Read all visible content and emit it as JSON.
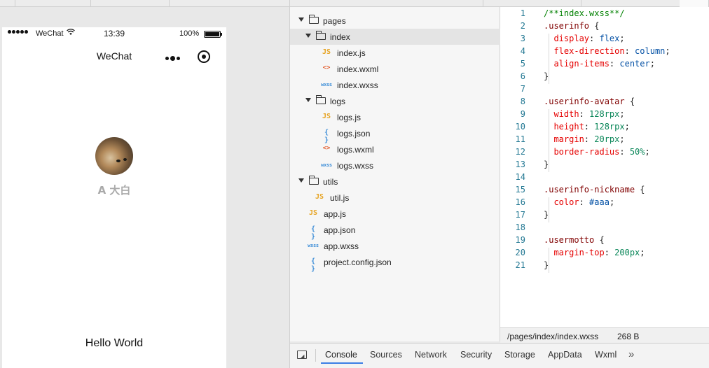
{
  "simulator": {
    "status": {
      "carrier": "WeChat",
      "time": "13:39",
      "battery_pct": "100%",
      "battery_level": 1.0
    },
    "nav_title": "WeChat",
    "nickname": "A 大白",
    "motto": "Hello World"
  },
  "filetree": {
    "items": [
      {
        "label": "pages",
        "type": "folder",
        "indent": 0,
        "expanded": true
      },
      {
        "label": "index",
        "type": "folder",
        "indent": 1,
        "expanded": true,
        "selected": true
      },
      {
        "label": "index.js",
        "type": "js",
        "indent": 2,
        "icon": "JS"
      },
      {
        "label": "index.wxml",
        "type": "wxml",
        "indent": 2,
        "icon": "<>"
      },
      {
        "label": "index.wxss",
        "type": "wxss",
        "indent": 2,
        "icon": "wxss"
      },
      {
        "label": "logs",
        "type": "folder",
        "indent": 1,
        "expanded": true
      },
      {
        "label": "logs.js",
        "type": "js",
        "indent": 2,
        "icon": "JS"
      },
      {
        "label": "logs.json",
        "type": "json",
        "indent": 2,
        "icon": "{ }"
      },
      {
        "label": "logs.wxml",
        "type": "wxml",
        "indent": 2,
        "icon": "<>"
      },
      {
        "label": "logs.wxss",
        "type": "wxss",
        "indent": 2,
        "icon": "wxss"
      },
      {
        "label": "utils",
        "type": "folder",
        "indent": 0,
        "expanded": true
      },
      {
        "label": "util.js",
        "type": "js",
        "indent": 1,
        "icon": "JS"
      },
      {
        "label": "app.js",
        "type": "js",
        "indent": 0,
        "icon": "JS"
      },
      {
        "label": "app.json",
        "type": "json",
        "indent": 0,
        "icon": "{ }"
      },
      {
        "label": "app.wxss",
        "type": "wxss",
        "indent": 0,
        "icon": "wxss"
      },
      {
        "label": "project.config.json",
        "type": "json",
        "indent": 0,
        "icon": "{ }"
      }
    ]
  },
  "editor": {
    "lines": [
      {
        "n": "1",
        "tokens": [
          [
            "c-comment",
            "/**index.wxss**/"
          ]
        ]
      },
      {
        "n": "2",
        "tokens": [
          [
            "c-selector",
            ".userinfo"
          ],
          [
            "c-punc",
            " {"
          ]
        ]
      },
      {
        "n": "3",
        "tokens": [
          [
            "c-prop",
            "  display"
          ],
          [
            "c-punc",
            ": "
          ],
          [
            "c-value",
            "flex"
          ],
          [
            "c-punc",
            ";"
          ]
        ]
      },
      {
        "n": "4",
        "tokens": [
          [
            "c-prop",
            "  flex-direction"
          ],
          [
            "c-punc",
            ": "
          ],
          [
            "c-value",
            "column"
          ],
          [
            "c-punc",
            ";"
          ]
        ]
      },
      {
        "n": "5",
        "tokens": [
          [
            "c-prop",
            "  align-items"
          ],
          [
            "c-punc",
            ": "
          ],
          [
            "c-value",
            "center"
          ],
          [
            "c-punc",
            ";"
          ]
        ]
      },
      {
        "n": "6",
        "tokens": [
          [
            "c-punc",
            "}"
          ]
        ]
      },
      {
        "n": "7",
        "tokens": []
      },
      {
        "n": "8",
        "tokens": [
          [
            "c-selector",
            ".userinfo-avatar"
          ],
          [
            "c-punc",
            " {"
          ]
        ]
      },
      {
        "n": "9",
        "tokens": [
          [
            "c-prop",
            "  width"
          ],
          [
            "c-punc",
            ": "
          ],
          [
            "c-num",
            "128rpx"
          ],
          [
            "c-punc",
            ";"
          ]
        ]
      },
      {
        "n": "10",
        "tokens": [
          [
            "c-prop",
            "  height"
          ],
          [
            "c-punc",
            ": "
          ],
          [
            "c-num",
            "128rpx"
          ],
          [
            "c-punc",
            ";"
          ]
        ]
      },
      {
        "n": "11",
        "tokens": [
          [
            "c-prop",
            "  margin"
          ],
          [
            "c-punc",
            ": "
          ],
          [
            "c-num",
            "20rpx"
          ],
          [
            "c-punc",
            ";"
          ]
        ]
      },
      {
        "n": "12",
        "tokens": [
          [
            "c-prop",
            "  border-radius"
          ],
          [
            "c-punc",
            ": "
          ],
          [
            "c-num",
            "50%"
          ],
          [
            "c-punc",
            ";"
          ]
        ]
      },
      {
        "n": "13",
        "tokens": [
          [
            "c-punc",
            "}"
          ]
        ]
      },
      {
        "n": "14",
        "tokens": []
      },
      {
        "n": "15",
        "tokens": [
          [
            "c-selector",
            ".userinfo-nickname"
          ],
          [
            "c-punc",
            " {"
          ]
        ]
      },
      {
        "n": "16",
        "tokens": [
          [
            "c-prop",
            "  color"
          ],
          [
            "c-punc",
            ": "
          ],
          [
            "c-value",
            "#aaa"
          ],
          [
            "c-punc",
            ";"
          ]
        ]
      },
      {
        "n": "17",
        "tokens": [
          [
            "c-punc",
            "}"
          ]
        ]
      },
      {
        "n": "18",
        "tokens": []
      },
      {
        "n": "19",
        "tokens": [
          [
            "c-selector",
            ".usermotto"
          ],
          [
            "c-punc",
            " {"
          ]
        ]
      },
      {
        "n": "20",
        "tokens": [
          [
            "c-prop",
            "  margin-top"
          ],
          [
            "c-punc",
            ": "
          ],
          [
            "c-num",
            "200px"
          ],
          [
            "c-punc",
            ";"
          ]
        ]
      },
      {
        "n": "21",
        "tokens": [
          [
            "c-punc",
            "}"
          ]
        ]
      }
    ],
    "status_path": "/pages/index/index.wxss",
    "status_size": "268 B"
  },
  "devtools": {
    "tabs": [
      "Console",
      "Sources",
      "Network",
      "Security",
      "Storage",
      "AppData",
      "Wxml"
    ],
    "active_tab": "Console",
    "more": "»"
  },
  "colors": {
    "accent": "#3b7ee5",
    "nickname": "#aaaaaa",
    "line_number": "#237893"
  }
}
